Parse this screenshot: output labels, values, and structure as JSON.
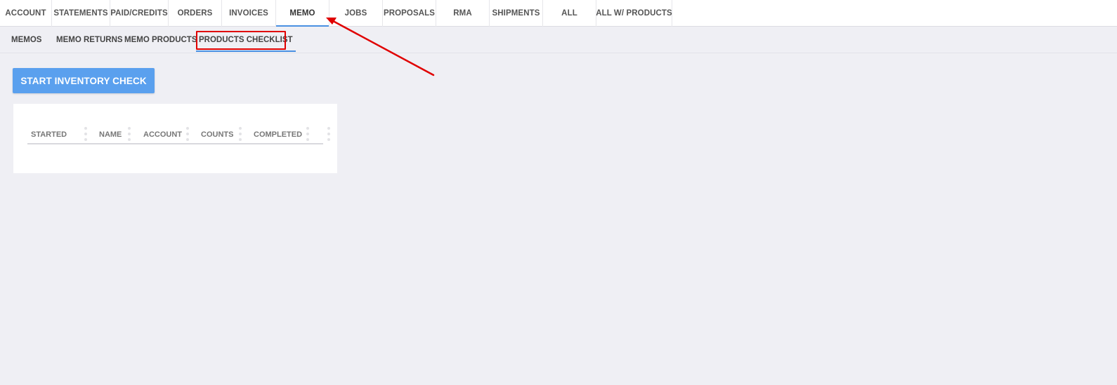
{
  "top_tabs": [
    {
      "label": "ACCOUNT"
    },
    {
      "label": "STATEMENTS"
    },
    {
      "label": "PAID/CREDITS"
    },
    {
      "label": "ORDERS"
    },
    {
      "label": "INVOICES"
    },
    {
      "label": "MEMO",
      "active": true
    },
    {
      "label": "JOBS"
    },
    {
      "label": "PROPOSALS"
    },
    {
      "label": "RMA"
    },
    {
      "label": "SHIPMENTS"
    },
    {
      "label": "ALL"
    },
    {
      "label": "ALL W/ PRODUCTS"
    }
  ],
  "sub_tabs": [
    {
      "label": "MEMOS"
    },
    {
      "label": "MEMO RETURNS"
    },
    {
      "label": "MEMO PRODUCTS"
    },
    {
      "label": "PRODUCTS CHECKLIST",
      "active": true
    }
  ],
  "actions": {
    "start_inventory_check": "START INVENTORY CHECK"
  },
  "table": {
    "columns": [
      "STARTED",
      "NAME",
      "ACCOUNT",
      "COUNTS",
      "COMPLETED"
    ],
    "rows": []
  },
  "colors": {
    "accent": "#4a90e2",
    "button": "#5aa0ee",
    "annotation": "#e00000",
    "background": "#efeff4"
  }
}
